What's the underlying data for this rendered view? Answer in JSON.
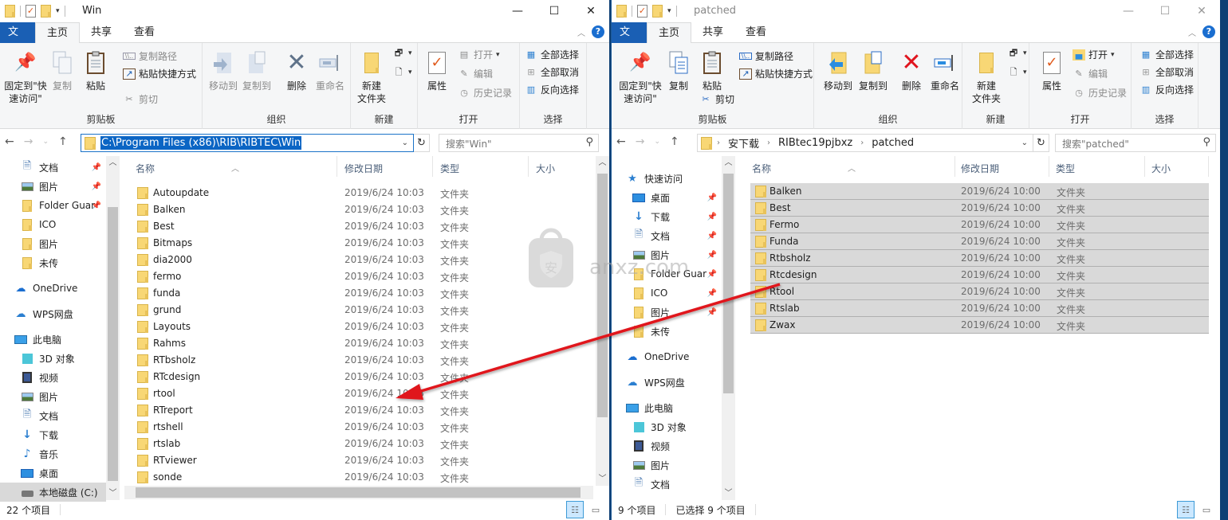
{
  "left_window": {
    "title": "Win",
    "tabs": {
      "file": "文件",
      "home": "主页",
      "share": "共享",
      "view": "查看"
    },
    "ribbon": {
      "clipboard": {
        "label": "剪贴板",
        "pin": "固定到\"快\n速访问\"",
        "copy": "复制",
        "paste": "粘贴",
        "copy_path": "复制路径",
        "paste_shortcut": "粘贴快捷方式",
        "cut": "剪切"
      },
      "organize": {
        "label": "组织",
        "move_to": "移动到",
        "copy_to": "复制到",
        "delete": "删除",
        "rename": "重命名"
      },
      "new": {
        "label": "新建",
        "new_folder": "新建\n文件夹"
      },
      "open": {
        "label": "打开",
        "properties": "属性",
        "open": "打开",
        "edit": "编辑",
        "history": "历史记录"
      },
      "select": {
        "label": "选择",
        "select_all": "全部选择",
        "select_none": "全部取消",
        "invert": "反向选择"
      }
    },
    "address": {
      "path": "C:\\Program Files (x86)\\RIB\\RIBTEC\\Win",
      "search_placeholder": "搜索\"Win\""
    },
    "nav_items": [
      {
        "label": "文档",
        "icon": "document-icon",
        "pinned": true
      },
      {
        "label": "图片",
        "icon": "pictures-icon",
        "pinned": true
      },
      {
        "label": "Folder Guar",
        "icon": "folder-icon",
        "pinned": true
      },
      {
        "label": "ICO",
        "icon": "folder-icon",
        "pinned": false
      },
      {
        "label": "图片",
        "icon": "folder-icon",
        "pinned": false
      },
      {
        "label": "未传",
        "icon": "folder-icon",
        "pinned": false
      },
      {
        "label": "OneDrive",
        "icon": "onedrive-icon",
        "pinned": false
      },
      {
        "label": "WPS网盘",
        "icon": "cloud-icon",
        "pinned": false
      },
      {
        "label": "此电脑",
        "icon": "pc-icon",
        "pinned": false
      },
      {
        "label": "3D 对象",
        "icon": "3d-objects-icon",
        "pinned": false
      },
      {
        "label": "视频",
        "icon": "video-icon",
        "pinned": false
      },
      {
        "label": "图片",
        "icon": "pictures-icon",
        "pinned": false
      },
      {
        "label": "文档",
        "icon": "document-icon",
        "pinned": false
      },
      {
        "label": "下载",
        "icon": "download-icon",
        "pinned": false
      },
      {
        "label": "音乐",
        "icon": "music-icon",
        "pinned": false
      },
      {
        "label": "桌面",
        "icon": "desktop-icon",
        "pinned": false
      },
      {
        "label": "本地磁盘 (C:)",
        "icon": "drive-icon",
        "pinned": false,
        "selected": true
      }
    ],
    "columns": {
      "name": "名称",
      "date": "修改日期",
      "type": "类型",
      "size": "大小"
    },
    "files": [
      {
        "name": "Autoupdate",
        "date": "2019/6/24 10:03",
        "type": "文件夹"
      },
      {
        "name": "Balken",
        "date": "2019/6/24 10:03",
        "type": "文件夹"
      },
      {
        "name": "Best",
        "date": "2019/6/24 10:03",
        "type": "文件夹"
      },
      {
        "name": "Bitmaps",
        "date": "2019/6/24 10:03",
        "type": "文件夹"
      },
      {
        "name": "dia2000",
        "date": "2019/6/24 10:03",
        "type": "文件夹"
      },
      {
        "name": "fermo",
        "date": "2019/6/24 10:03",
        "type": "文件夹"
      },
      {
        "name": "funda",
        "date": "2019/6/24 10:03",
        "type": "文件夹"
      },
      {
        "name": "grund",
        "date": "2019/6/24 10:03",
        "type": "文件夹"
      },
      {
        "name": "Layouts",
        "date": "2019/6/24 10:03",
        "type": "文件夹"
      },
      {
        "name": "Rahms",
        "date": "2019/6/24 10:03",
        "type": "文件夹"
      },
      {
        "name": "RTbsholz",
        "date": "2019/6/24 10:03",
        "type": "文件夹"
      },
      {
        "name": "RTcdesign",
        "date": "2019/6/24 10:03",
        "type": "文件夹"
      },
      {
        "name": "rtool",
        "date": "2019/6/24 10:03",
        "type": "文件夹"
      },
      {
        "name": "RTreport",
        "date": "2019/6/24 10:03",
        "type": "文件夹"
      },
      {
        "name": "rtshell",
        "date": "2019/6/24 10:03",
        "type": "文件夹"
      },
      {
        "name": "rtslab",
        "date": "2019/6/24 10:03",
        "type": "文件夹"
      },
      {
        "name": "RTviewer",
        "date": "2019/6/24 10:03",
        "type": "文件夹"
      },
      {
        "name": "sonde",
        "date": "2019/6/24 10:03",
        "type": "文件夹"
      }
    ],
    "status": {
      "count": "22 个项目"
    }
  },
  "right_window": {
    "title": "patched",
    "tabs": {
      "file": "文件",
      "home": "主页",
      "share": "共享",
      "view": "查看"
    },
    "ribbon": {
      "clipboard": {
        "label": "剪贴板",
        "pin": "固定到\"快\n速访问\"",
        "copy": "复制",
        "paste": "粘贴",
        "copy_path": "复制路径",
        "paste_shortcut": "粘贴快捷方式",
        "cut": "剪切"
      },
      "organize": {
        "label": "组织",
        "move_to": "移动到",
        "copy_to": "复制到",
        "delete": "删除",
        "rename": "重命名"
      },
      "new": {
        "label": "新建",
        "new_folder": "新建\n文件夹"
      },
      "open": {
        "label": "打开",
        "properties": "属性",
        "open": "打开",
        "edit": "编辑",
        "history": "历史记录"
      },
      "select": {
        "label": "选择",
        "select_all": "全部选择",
        "select_none": "全部取消",
        "invert": "反向选择"
      }
    },
    "address": {
      "breadcrumbs": [
        "安下载",
        "RIBtec19pjbxz",
        "patched"
      ],
      "search_placeholder": "搜索\"patched\""
    },
    "nav_items": [
      {
        "label": "快速访问",
        "icon": "quick-access-star-icon",
        "pinned": false
      },
      {
        "label": "桌面",
        "icon": "desktop-icon",
        "pinned": true
      },
      {
        "label": "下载",
        "icon": "download-icon",
        "pinned": true
      },
      {
        "label": "文档",
        "icon": "document-icon",
        "pinned": true
      },
      {
        "label": "图片",
        "icon": "pictures-icon",
        "pinned": true
      },
      {
        "label": "Folder Guar",
        "icon": "folder-icon",
        "pinned": true
      },
      {
        "label": "ICO",
        "icon": "folder-icon",
        "pinned": true
      },
      {
        "label": "图片",
        "icon": "folder-icon",
        "pinned": true
      },
      {
        "label": "未传",
        "icon": "folder-icon",
        "pinned": false
      },
      {
        "label": "OneDrive",
        "icon": "onedrive-icon",
        "pinned": false
      },
      {
        "label": "WPS网盘",
        "icon": "cloud-icon",
        "pinned": false
      },
      {
        "label": "此电脑",
        "icon": "pc-icon",
        "pinned": false
      },
      {
        "label": "3D 对象",
        "icon": "3d-objects-icon",
        "pinned": false
      },
      {
        "label": "视频",
        "icon": "video-icon",
        "pinned": false
      },
      {
        "label": "图片",
        "icon": "pictures-icon",
        "pinned": false
      },
      {
        "label": "文档",
        "icon": "document-icon",
        "pinned": false
      }
    ],
    "columns": {
      "name": "名称",
      "date": "修改日期",
      "type": "类型",
      "size": "大小"
    },
    "files": [
      {
        "name": "Balken",
        "date": "2019/6/24 10:00",
        "type": "文件夹"
      },
      {
        "name": "Best",
        "date": "2019/6/24 10:00",
        "type": "文件夹"
      },
      {
        "name": "Fermo",
        "date": "2019/6/24 10:00",
        "type": "文件夹"
      },
      {
        "name": "Funda",
        "date": "2019/6/24 10:00",
        "type": "文件夹"
      },
      {
        "name": "Rtbsholz",
        "date": "2019/6/24 10:00",
        "type": "文件夹"
      },
      {
        "name": "Rtcdesign",
        "date": "2019/6/24 10:00",
        "type": "文件夹"
      },
      {
        "name": "Rtool",
        "date": "2019/6/24 10:00",
        "type": "文件夹"
      },
      {
        "name": "Rtslab",
        "date": "2019/6/24 10:00",
        "type": "文件夹"
      },
      {
        "name": "Zwax",
        "date": "2019/6/24 10:00",
        "type": "文件夹"
      }
    ],
    "status": {
      "count": "9 个项目",
      "selected": "已选择 9 个项目"
    }
  },
  "watermark": {
    "text": "anxz.com",
    "badge": "安"
  },
  "colors": {
    "accent": "#1a5fb4",
    "selection": "#d9d9d9",
    "arrow": "#e0141e",
    "desktop": "#0d3f74"
  }
}
